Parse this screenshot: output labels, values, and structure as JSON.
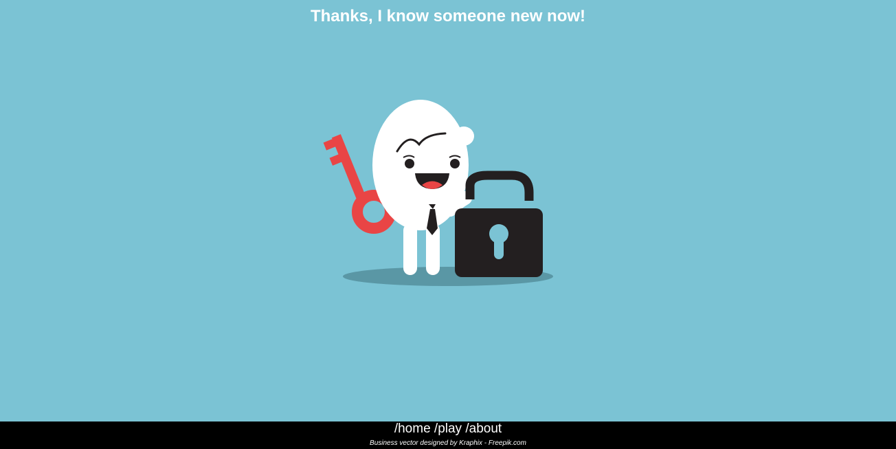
{
  "headline": "Thanks, I know someone new now!",
  "illustration": {
    "subject": "mascot-with-key-and-unlocked-padlock",
    "icons": [
      "key-icon",
      "padlock-unlocked-icon"
    ]
  },
  "nav": {
    "home": "/home",
    "play": "/play",
    "about": "/about"
  },
  "footer": {
    "credit": "Business vector designed by Kraphix - Freepik.com"
  },
  "colors": {
    "background": "#7bc3d4",
    "footer_bg": "#000000",
    "key": "#e94545",
    "lock": "#231f20",
    "mascot": "#ffffff",
    "shadow": "#5a97a5"
  }
}
